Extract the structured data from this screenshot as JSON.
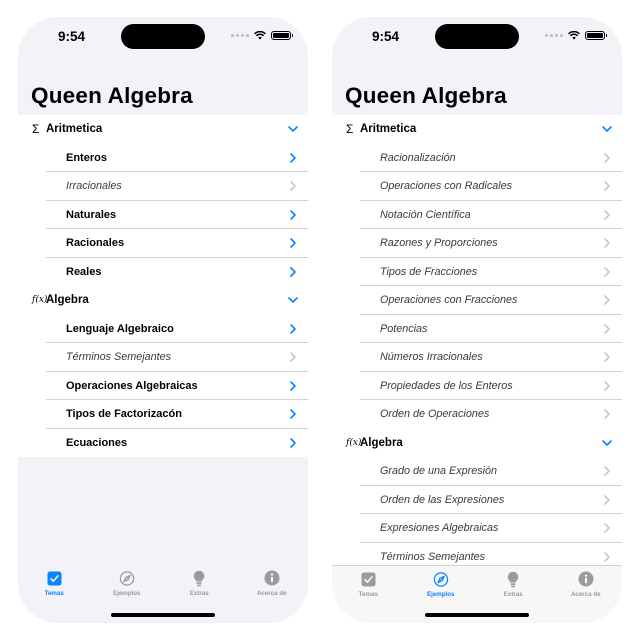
{
  "colors": {
    "accent": "#0a84ff",
    "chevron_dim": "#c7c7cc",
    "inactive_tab": "#9b9b9b"
  },
  "left": {
    "status": {
      "time": "9:54"
    },
    "title": "Queen Algebra",
    "rows": [
      {
        "kind": "section",
        "icon": "sigma-icon",
        "label": "Aritmetica"
      },
      {
        "kind": "folder",
        "label": "Enteros"
      },
      {
        "kind": "doc",
        "label": "Irracionales"
      },
      {
        "kind": "folder",
        "label": "Naturales"
      },
      {
        "kind": "folder",
        "label": "Racionales"
      },
      {
        "kind": "folder",
        "label": "Reales"
      },
      {
        "kind": "section",
        "icon": "function-icon",
        "label": "Algebra"
      },
      {
        "kind": "folder",
        "label": "Lenguaje Algebraico"
      },
      {
        "kind": "doc",
        "label": "Términos Semejantes"
      },
      {
        "kind": "folder",
        "label": "Operaciones Algebraicas"
      },
      {
        "kind": "folder",
        "label": "Tipos de Factorizacón"
      },
      {
        "kind": "folder",
        "label": "Ecuaciones"
      }
    ],
    "tabs": [
      {
        "name": "Temas",
        "icon": "checkbox-icon",
        "active": true
      },
      {
        "name": "Ejemplos",
        "icon": "compass-icon",
        "active": false
      },
      {
        "name": "Extras",
        "icon": "lightbulb-icon",
        "active": false
      },
      {
        "name": "Acerca de",
        "icon": "info-icon",
        "active": false
      }
    ]
  },
  "right": {
    "status": {
      "time": "9:54"
    },
    "title": "Queen Algebra",
    "rows": [
      {
        "kind": "section",
        "icon": "sigma-icon",
        "label": "Aritmetica"
      },
      {
        "kind": "doc",
        "label": "Racionalización"
      },
      {
        "kind": "doc",
        "label": "Operaciones con Radicales"
      },
      {
        "kind": "doc",
        "label": "Notación Científica"
      },
      {
        "kind": "doc",
        "label": "Razones y Proporciones"
      },
      {
        "kind": "doc",
        "label": "Tipos de Fracciones"
      },
      {
        "kind": "doc",
        "label": "Operaciones con Fracciones"
      },
      {
        "kind": "doc",
        "label": "Potencias"
      },
      {
        "kind": "doc",
        "label": "Números Irracionales"
      },
      {
        "kind": "doc",
        "label": "Propiedades de los Enteros"
      },
      {
        "kind": "doc",
        "label": "Orden de Operaciones"
      },
      {
        "kind": "section",
        "icon": "function-icon",
        "label": "Algebra"
      },
      {
        "kind": "doc",
        "label": "Grado de una Expresión"
      },
      {
        "kind": "doc",
        "label": "Orden de las Expresiones"
      },
      {
        "kind": "doc",
        "label": "Expresiones Algebraicas"
      },
      {
        "kind": "doc",
        "label": "Términos Semejantes"
      }
    ],
    "tabs": [
      {
        "name": "Temas",
        "icon": "checkbox-icon",
        "active": false
      },
      {
        "name": "Ejemplos",
        "icon": "compass-icon",
        "active": true
      },
      {
        "name": "Extras",
        "icon": "lightbulb-icon",
        "active": false
      },
      {
        "name": "Acerca de",
        "icon": "info-icon",
        "active": false
      }
    ]
  }
}
